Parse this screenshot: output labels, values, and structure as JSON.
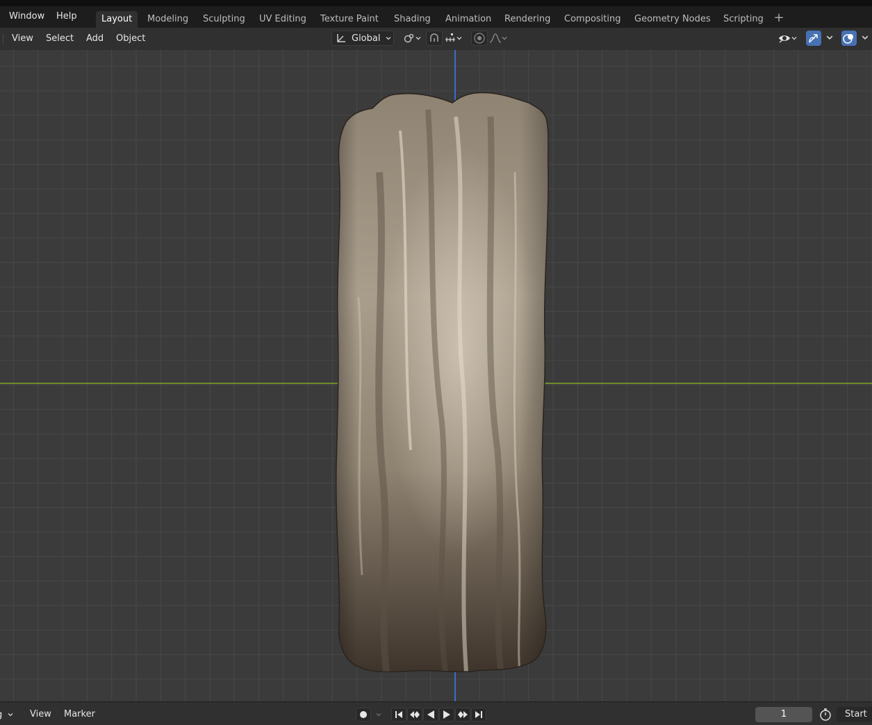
{
  "topbar": {
    "menus": [
      "Window",
      "Help"
    ],
    "workspace_tabs": [
      "Layout",
      "Modeling",
      "Sculpting",
      "UV Editing",
      "Texture Paint",
      "Shading",
      "Animation",
      "Rendering",
      "Compositing",
      "Geometry Nodes",
      "Scripting"
    ],
    "active_tab": "Layout",
    "add_workspace": "+"
  },
  "viewport_header": {
    "menus": [
      "View",
      "Select",
      "Add",
      "Object"
    ],
    "transform_orientation": "Global",
    "icons": [
      "transform-orientation-icon",
      "pivot-point-icon",
      "snap-icon",
      "snap-increment-icon",
      "proportional-editing-icon",
      "falloff-icon",
      "visibility-eye-icon",
      "gizmo-icon",
      "overlays-icon"
    ]
  },
  "viewport": {
    "object": "cloth",
    "axis_x_color": "#6e8a2b",
    "axis_z_color": "#3d6ad1",
    "background_color": "#3b3b3b"
  },
  "timeline": {
    "playback_label": "g",
    "menus": [
      "View",
      "Marker"
    ],
    "current_frame": "1",
    "start_label": "Start"
  }
}
